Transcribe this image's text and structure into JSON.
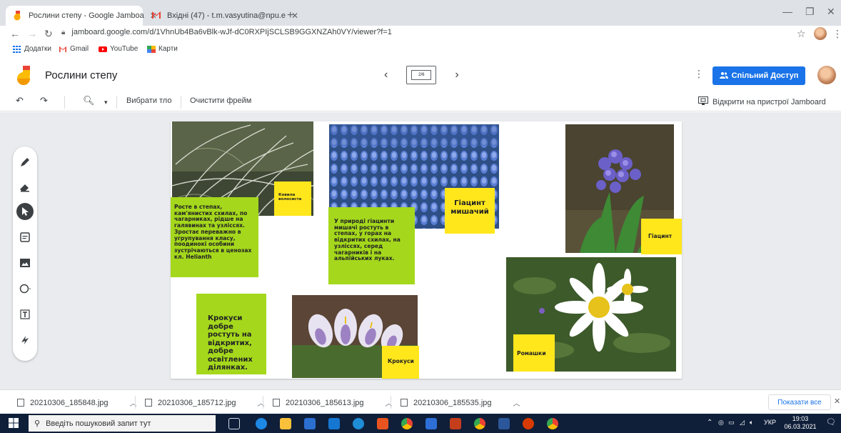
{
  "browser": {
    "tabs": [
      {
        "title": "Рослини степу - Google Jamboa",
        "active": true
      },
      {
        "title": "Вхідні (47) - t.m.vasyutina@npu.e",
        "active": false
      }
    ],
    "url": "jamboard.google.com/d/1VhnUb4Ba6vBlk-wJf-dC0RXPIjSCLSB9GGXNZAh0VY/viewer?f=1",
    "bookmarks": [
      "Додатки",
      "Gmail",
      "YouTube",
      "Карти"
    ]
  },
  "jamboard": {
    "title": "Рослини степу",
    "frame_indicator": "2/6",
    "share_label": "Спільний Доступ",
    "toolbar": {
      "set_background": "Вибрати тло",
      "clear_frame": "Очистити фрейм",
      "open_on_device": "Відкрити на пристрої Jamboard"
    }
  },
  "notes": {
    "kovyla_desc": "Росте в степах, кам'янистих схилах, по чагарниках, рідше на галявинах та узліссях. Зростає переважно в угрупування класу, поодинокі особини зустрічаються в ценозах кл. Helianth",
    "kovyla_label": "Ковила волосиста",
    "hyacinth_mouse_desc": "У природі гіацинти мишачі ростуть в степах, у горах на відкритих схилах, на узліссях, серед чагарників і на альпійських луках.",
    "hyacinth_mouse_label": "Гіацинт мишачий",
    "hyacinth_label": "Гіацинт",
    "crocus_desc": "Крокуси добре ростуть на відкритих, добре освітлених ділянках.",
    "crocus_label": "Крокуси",
    "chamomile_label": "Ромашки"
  },
  "downloads": {
    "files": [
      "20210306_185848.jpg",
      "20210306_185712.jpg",
      "20210306_185613.jpg",
      "20210306_185535.jpg"
    ],
    "show_all": "Показати все"
  },
  "taskbar": {
    "search_placeholder": "Введіть пошуковий запит тут",
    "lang": "УКР",
    "time": "19:03",
    "date": "06.03.2021"
  },
  "colors": {
    "green_note": "#a5d81c",
    "yellow_note": "#ffe71c",
    "share_blue": "#1a73e8"
  }
}
